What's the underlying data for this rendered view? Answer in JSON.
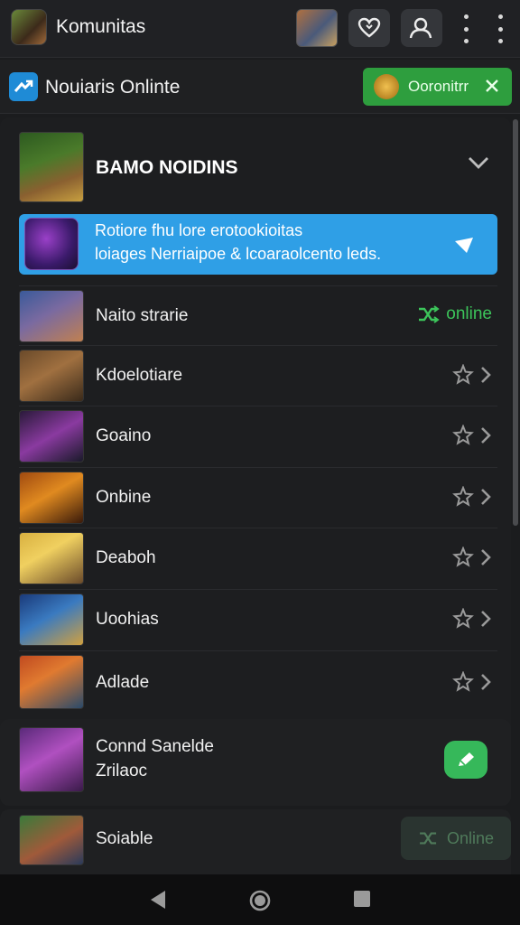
{
  "topbar": {
    "title": "Komunitas",
    "avatar_icon": "profile-avatar",
    "game_thumb_icon": "game-thumbnail",
    "heart_icon": "heart-icon",
    "user_icon": "users-icon",
    "more_icon": "more-vertical-icon"
  },
  "secbar": {
    "title": "Nouiaris Onlinte",
    "pill_label": "Ooronitrr",
    "pill_color": "#2e9e3e"
  },
  "section": {
    "title": "BAMO NOIDINS"
  },
  "banner": {
    "line1": "Rotiore fhu lore erotookioitas",
    "line2": "loiages Nerriaipoe & lcoaraolcento leds.",
    "color": "#2f9fe6"
  },
  "rows": [
    {
      "label": "Naito strarie",
      "status": "online",
      "status_color": "#3cc45a"
    },
    {
      "label": "Kdoelotiare"
    },
    {
      "label": "Goaino"
    },
    {
      "label": "Onbine"
    },
    {
      "label": "Deaboh"
    },
    {
      "label": "Uoohias"
    },
    {
      "label": "Adlade"
    }
  ],
  "big_row": {
    "line1": "Connd Sanelde",
    "line2": "Zrilaoc"
  },
  "last_row": {
    "label": "Soiable",
    "button_label": "Online"
  }
}
